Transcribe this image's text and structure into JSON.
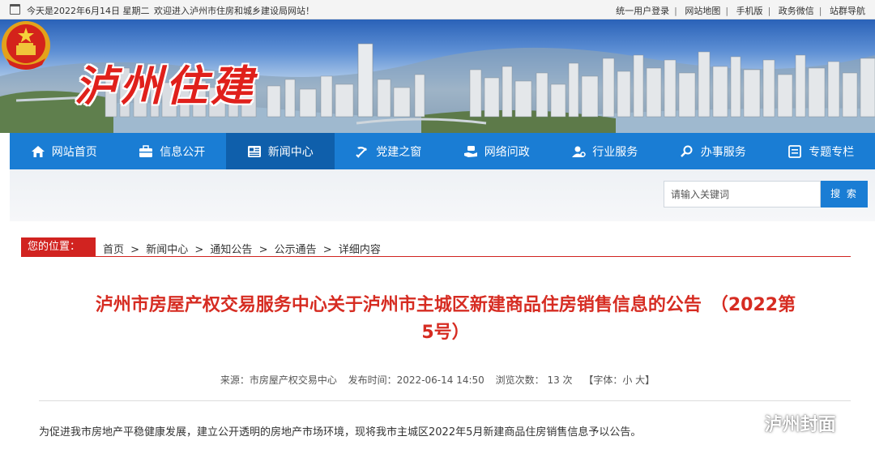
{
  "topbar": {
    "date": "今天是2022年6月14日 星期二",
    "welcome": "欢迎进入泸州市住房和城乡建设局网站！",
    "links": [
      "统一用户登录",
      "网站地图",
      "手机版",
      "政务微信",
      "站群导航"
    ]
  },
  "header": {
    "brand": "泸州住建"
  },
  "nav": [
    {
      "label": "网站首页",
      "icon": "home-icon"
    },
    {
      "label": "信息公开",
      "icon": "briefcase-icon"
    },
    {
      "label": "新闻中心",
      "icon": "newspaper-icon",
      "active": true
    },
    {
      "label": "党建之窗",
      "icon": "party-emblem-icon"
    },
    {
      "label": "网络问政",
      "icon": "chat-hand-icon"
    },
    {
      "label": "行业服务",
      "icon": "service-user-icon"
    },
    {
      "label": "办事服务",
      "icon": "magnifier-icon"
    },
    {
      "label": "专题专栏",
      "icon": "square-list-icon"
    }
  ],
  "search": {
    "placeholder": "请输入关键词",
    "button": "搜 索"
  },
  "breadcrumb": {
    "label": "您的位置：",
    "items": [
      "首页",
      "新闻中心",
      "通知公告",
      "公示通告",
      "详细内容"
    ],
    "separator": ">"
  },
  "article": {
    "title_line1": "泸州市房屋产权交易服务中心关于泸州市主城区新建商品住房销售信息的公告　（2022第",
    "title_line2": "5号）",
    "source": "来源：市房屋产权交易中心",
    "published": "发布时间：2022-06-14 14:50",
    "views": "浏览次数： 13  次",
    "font_size": "【字体：小 大】",
    "body": "为促进我市房地产平稳健康发展，建立公开透明的房地产市场环境，现将我市主城区2022年5月新建商品住房销售信息予以公告。"
  },
  "watermark": {
    "text": "泸州封面"
  },
  "colors": {
    "nav_blue": "#1a7dd4",
    "nav_active": "#0f5fab",
    "title_red": "#d62c22",
    "label_red": "#d12320"
  }
}
